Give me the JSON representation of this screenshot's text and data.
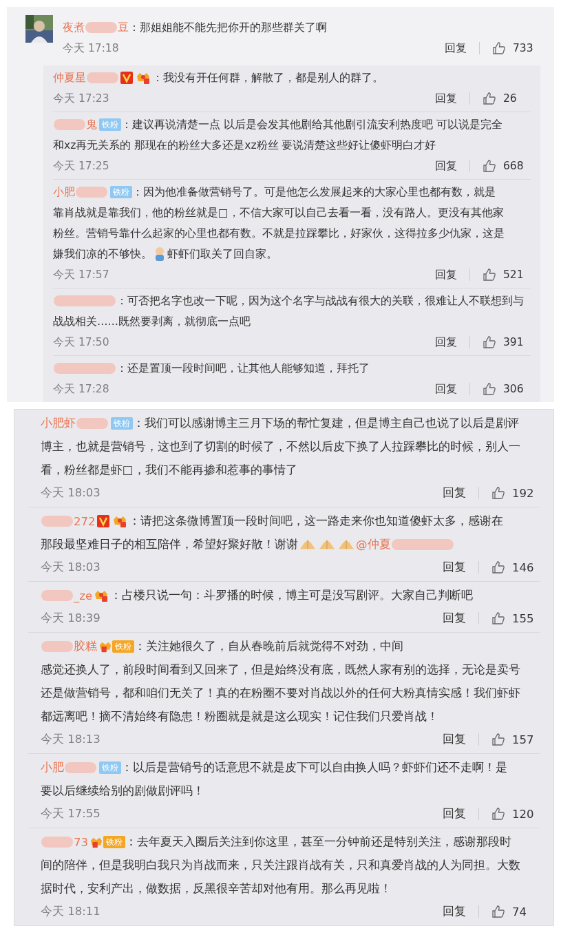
{
  "panels": [
    {
      "comments": [
        {
          "avatar": {
            "kind": "picture"
          },
          "name_lead": "夜煮",
          "name_tail": "豆",
          "lines": [
            [
              {
                "kind": "text",
                "text": "：那姐姐能不能先把你开的那些群关了啊"
              }
            ]
          ],
          "time": "今天 17:18",
          "reply_label": "回复",
          "likes": "733",
          "replies": [
            {
              "name_lead": "仲夏星",
              "badges": [
                {
                  "kind": "vip"
                },
                {
                  "kind": "crown"
                }
              ],
              "lines": [
                [
                  {
                    "kind": "text",
                    "text": "：我没有开任何群，解散了，都是别人的群了。"
                  }
                ]
              ],
              "time": "今天 17:23",
              "reply_label": "回复",
              "likes": "26"
            },
            {
              "name_tail": "鬼",
              "badges": [
                {
                  "kind": "fan",
                  "label": "铁粉"
                }
              ],
              "lines": [
                [
                  {
                    "kind": "text",
                    "text": "：建议再说清楚一点 以后是会发其他剧给其他剧引流安利热度吧 可以说是完全"
                  }
                ],
                [
                  {
                    "kind": "text",
                    "text": "和xz再无关系的 那现在的粉丝大多还是xz粉丝 要说清楚这些好让傻虾明白才好"
                  }
                ]
              ],
              "time": "今天 17:25",
              "reply_label": "回复",
              "likes": "668"
            },
            {
              "name_lead": "小肥",
              "badges": [
                {
                  "kind": "fan",
                  "label": "铁粉"
                }
              ],
              "lines": [
                [
                  {
                    "kind": "text",
                    "text": "：因为他准备做营销号了。可是他怎么发展起来的大家心里也都有数，就是"
                  }
                ],
                [
                  {
                    "kind": "text",
                    "text": "靠肖战就是靠我们，他的粉丝就是□，不信大家可以自己去看一看，没有路人。更没有其他家"
                  }
                ],
                [
                  {
                    "kind": "text",
                    "text": "粉丝。营销号靠什么起家的心里也都有数。不就是拉踩攀比，好家伙，这得拉多少仇家，这是"
                  }
                ],
                [
                  {
                    "kind": "text",
                    "text": "嫌我们凉的不够快。"
                  },
                  {
                    "kind": "figure-emoji"
                  },
                  {
                    "kind": "text",
                    "text": "虾虾们取关了回自家。"
                  }
                ]
              ],
              "time": "今天 17:57",
              "reply_label": "回复",
              "likes": "521"
            },
            {
              "lines": [
                [
                  {
                    "kind": "text",
                    "text": "：可否把名字也改一下呢，因为这个名字与战战有很大的关联，很难让人不联想到与"
                  }
                ],
                [
                  {
                    "kind": "text",
                    "text": "战战相关……既然要剥离，就彻底一点吧"
                  }
                ]
              ],
              "time": "今天 17:50",
              "reply_label": "回复",
              "likes": "391"
            },
            {
              "lines": [
                [
                  {
                    "kind": "text",
                    "text": "：还是置顶一段时间吧，让其他人能够知道，拜托了"
                  }
                ]
              ],
              "time": "今天 17:28",
              "reply_label": "回复",
              "likes": "306"
            }
          ]
        }
      ]
    },
    {
      "comments": [
        {
          "name_lead": "小肥虾",
          "badges": [
            {
              "kind": "fan",
              "label": "铁粉"
            }
          ],
          "lines": [
            [
              {
                "kind": "text",
                "text": "：我们可以感谢博主三月下场的帮忙复建，但是博主自己也说了以后是剧评"
              }
            ],
            [
              {
                "kind": "text",
                "text": "博主，也就是营销号，这也到了切割的时候了，不然以后皮下换了人拉踩攀比的时候，别人一"
              }
            ],
            [
              {
                "kind": "text",
                "text": "看，粉丝都是虾□，我们不能再掺和惹事的事情了"
              }
            ]
          ],
          "time": "今天 18:03",
          "reply_label": "回复",
          "likes": "192"
        },
        {
          "name_tail": "272",
          "badges": [
            {
              "kind": "vip"
            },
            {
              "kind": "crown"
            }
          ],
          "lines": [
            [
              {
                "kind": "text",
                "text": "：请把这条微博置顶一段时间吧，这一路走来你也知道傻虾太多，感谢在"
              }
            ],
            [
              {
                "kind": "text",
                "text": "那段最坚难日子的相互陪伴，希望好聚好散！谢谢"
              },
              {
                "kind": "hands-emoji"
              },
              {
                "kind": "hands-emoji"
              },
              {
                "kind": "hands-emoji"
              },
              {
                "kind": "mention",
                "text": "@仲夏"
              }
            ]
          ],
          "time": "今天 18:03",
          "reply_label": "回复",
          "likes": "146"
        },
        {
          "name_tail": "_ze",
          "badges": [
            {
              "kind": "crown"
            }
          ],
          "lines": [
            [
              {
                "kind": "text",
                "text": "：占楼只说一句：斗罗播的时候，博主可是没写剧评。大家自己判断吧"
              }
            ]
          ],
          "time": "今天 18:39",
          "reply_label": "回复",
          "likes": "155"
        },
        {
          "name_tail": "胶糕",
          "badges": [
            {
              "kind": "crown-fan",
              "label": "铁粉"
            }
          ],
          "lines": [
            [
              {
                "kind": "text",
                "text": "：关注她很久了，自从春晚前后就觉得不对劲，中间"
              }
            ],
            [
              {
                "kind": "text",
                "text": "感觉还换人了，前段时间看到又回来了，但是始终没有底，既然人家有别的选择，无论是卖号"
              }
            ],
            [
              {
                "kind": "text",
                "text": "还是做营销号，都和咱们无关了！真的在粉圈不要对肖战以外的任何大粉真情实感！我们虾虾"
              }
            ],
            [
              {
                "kind": "text",
                "text": "都远离吧！摘不清始终有隐患！粉圈就是就是这么现实！记住我们只爱肖战！"
              }
            ]
          ],
          "time": "今天 18:13",
          "reply_label": "回复",
          "likes": "157"
        },
        {
          "name_lead": "小肥",
          "badges": [
            {
              "kind": "fan",
              "label": "铁粉"
            }
          ],
          "lines": [
            [
              {
                "kind": "text",
                "text": "：以后是营销号的话意思不就是皮下可以自由换人吗？虾虾们还不走啊！是"
              }
            ],
            [
              {
                "kind": "text",
                "text": "要以后继续给别的剧做剧评吗！"
              }
            ]
          ],
          "time": "今天 17:55",
          "reply_label": "回复",
          "likes": "120"
        },
        {
          "name_tail": "73",
          "badges": [
            {
              "kind": "crown-fan",
              "label": "铁粉"
            }
          ],
          "lines": [
            [
              {
                "kind": "text",
                "text": "：去年夏天入圈后关注到你这里，甚至一分钟前还是特别关注，感谢那段时"
              }
            ],
            [
              {
                "kind": "text",
                "text": "间的陪伴，但是我明白我只为肖战而来，只关注跟肖战有关，只和真爱肖战的人为同担。大数"
              }
            ],
            [
              {
                "kind": "text",
                "text": "据时代，安利产出，做数据，反黑很辛苦却对他有用。那么再见啦！"
              }
            ]
          ],
          "time": "今天 18:11",
          "reply_label": "回复",
          "likes": "74"
        }
      ]
    }
  ]
}
